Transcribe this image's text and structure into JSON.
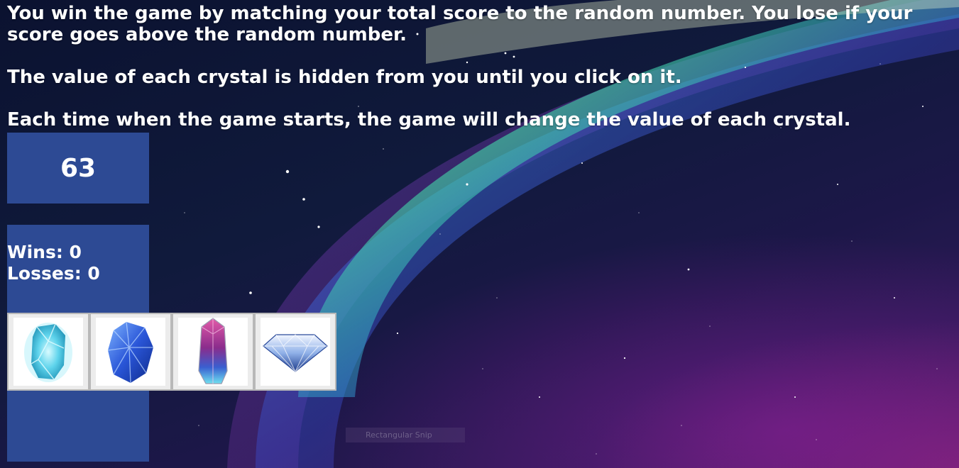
{
  "instructions": {
    "line1": "You win the game by matching your total score to the random number. You lose if your score goes above the random number.",
    "line2": "The value of each crystal is hidden from you until you click on it.",
    "line3": "Each time when the game starts, the game will change the value of each crystal."
  },
  "target": {
    "value": "63"
  },
  "scoreboard": {
    "wins_label": "Wins: 0",
    "losses_label": "Losses: 0"
  },
  "crystals": [
    {
      "name": "ice-crystal",
      "color": "#49c6e0"
    },
    {
      "name": "blue-crystal",
      "color": "#2f5fd6"
    },
    {
      "name": "magenta-crystal",
      "color": "#b23a8f"
    },
    {
      "name": "diamond",
      "color": "#3a5fb0"
    }
  ],
  "tooltip": {
    "text": "Rectangular Snip"
  },
  "colors": {
    "panel": "#2d4a94",
    "text": "#ffffff"
  }
}
